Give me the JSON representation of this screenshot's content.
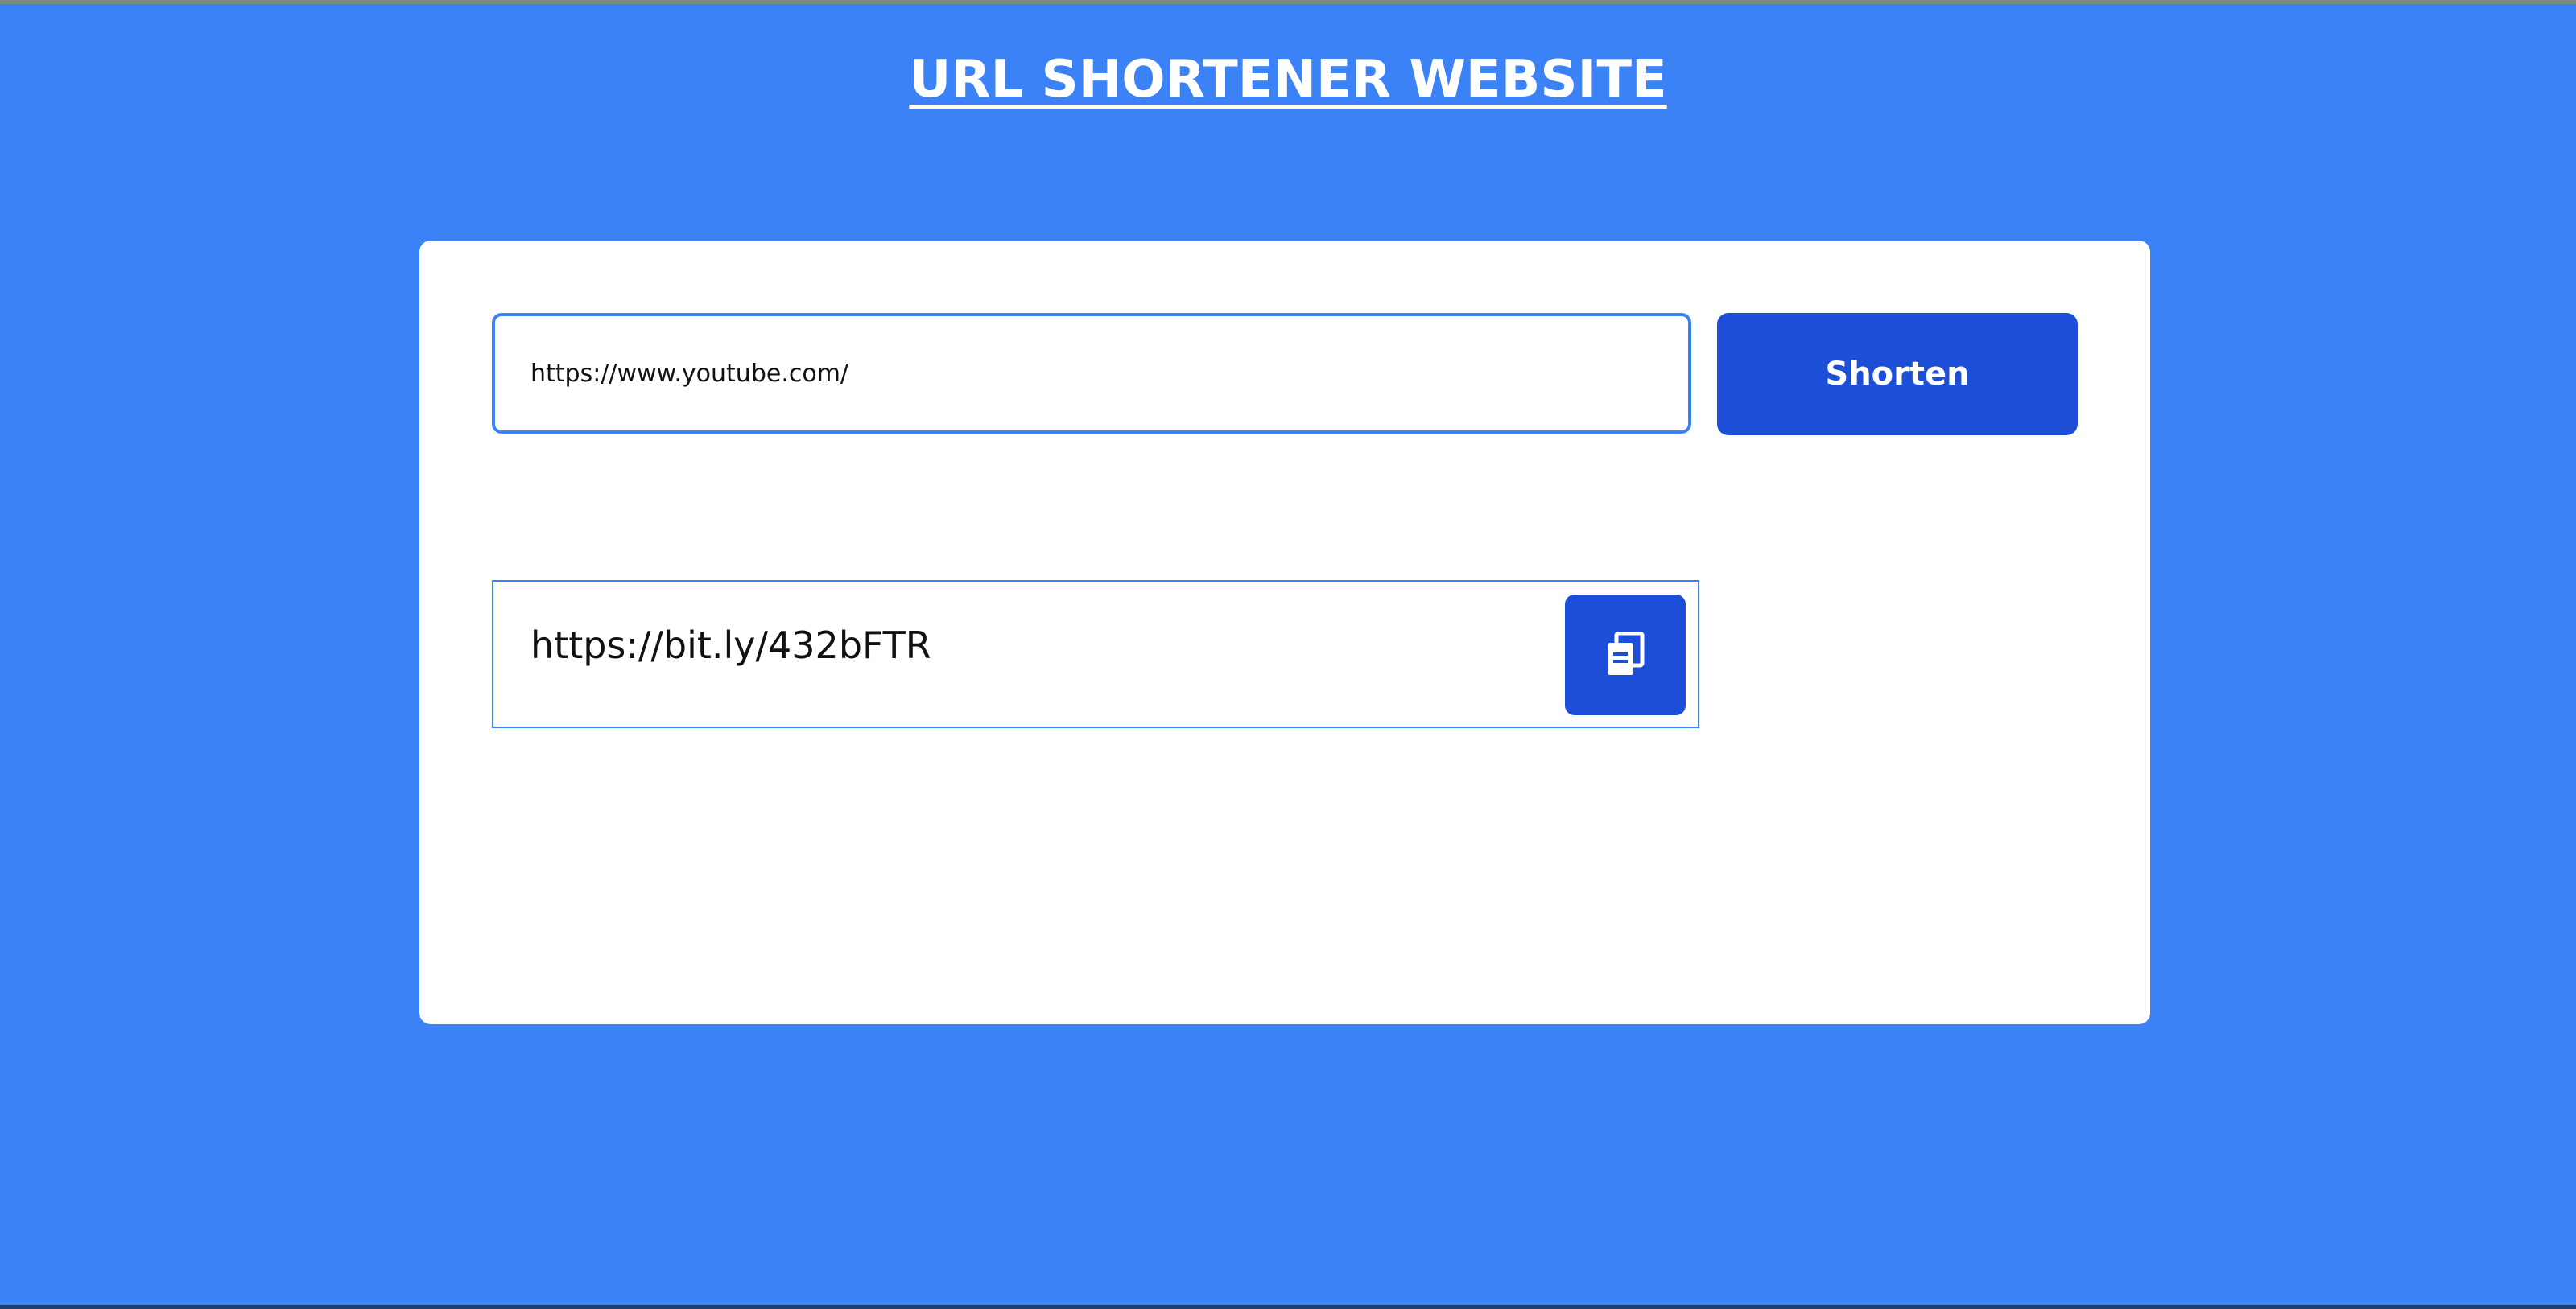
{
  "header": {
    "title": "URL SHORTENER WEBSITE"
  },
  "form": {
    "url_value": "https://www.youtube.com/",
    "shorten_label": "Shorten"
  },
  "result": {
    "short_url": "https://bit.ly/432bFTR",
    "copy_icon": "copy-icon"
  },
  "colors": {
    "background": "#3b82f6",
    "button": "#1d4ed8",
    "card": "#ffffff"
  }
}
